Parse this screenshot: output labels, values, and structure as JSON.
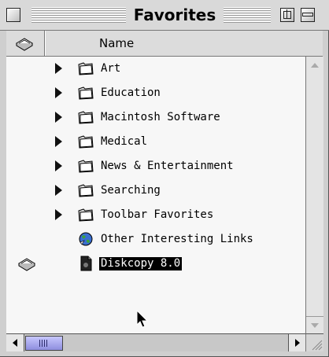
{
  "window": {
    "title": "Favorites"
  },
  "header": {
    "name_column": "Name"
  },
  "items": [
    {
      "label": "Art",
      "type": "folder",
      "expandable": true
    },
    {
      "label": "Education",
      "type": "folder",
      "expandable": true
    },
    {
      "label": "Macintosh Software",
      "type": "folder",
      "expandable": true
    },
    {
      "label": "Medical",
      "type": "folder",
      "expandable": true
    },
    {
      "label": "News & Entertainment",
      "type": "folder",
      "expandable": true
    },
    {
      "label": "Searching",
      "type": "folder",
      "expandable": true
    },
    {
      "label": "Toolbar Favorites",
      "type": "folder",
      "expandable": true
    },
    {
      "label": "Other Interesting Links",
      "type": "internet-link",
      "expandable": false
    },
    {
      "label": "Diskcopy 8.0",
      "type": "document",
      "expandable": false,
      "selected": true,
      "status_icon": "disk-stack-icon"
    }
  ],
  "colors": {
    "selection_bg": "#000000",
    "selection_fg": "#ffffff",
    "scroll_thumb": "#9a9aee"
  }
}
